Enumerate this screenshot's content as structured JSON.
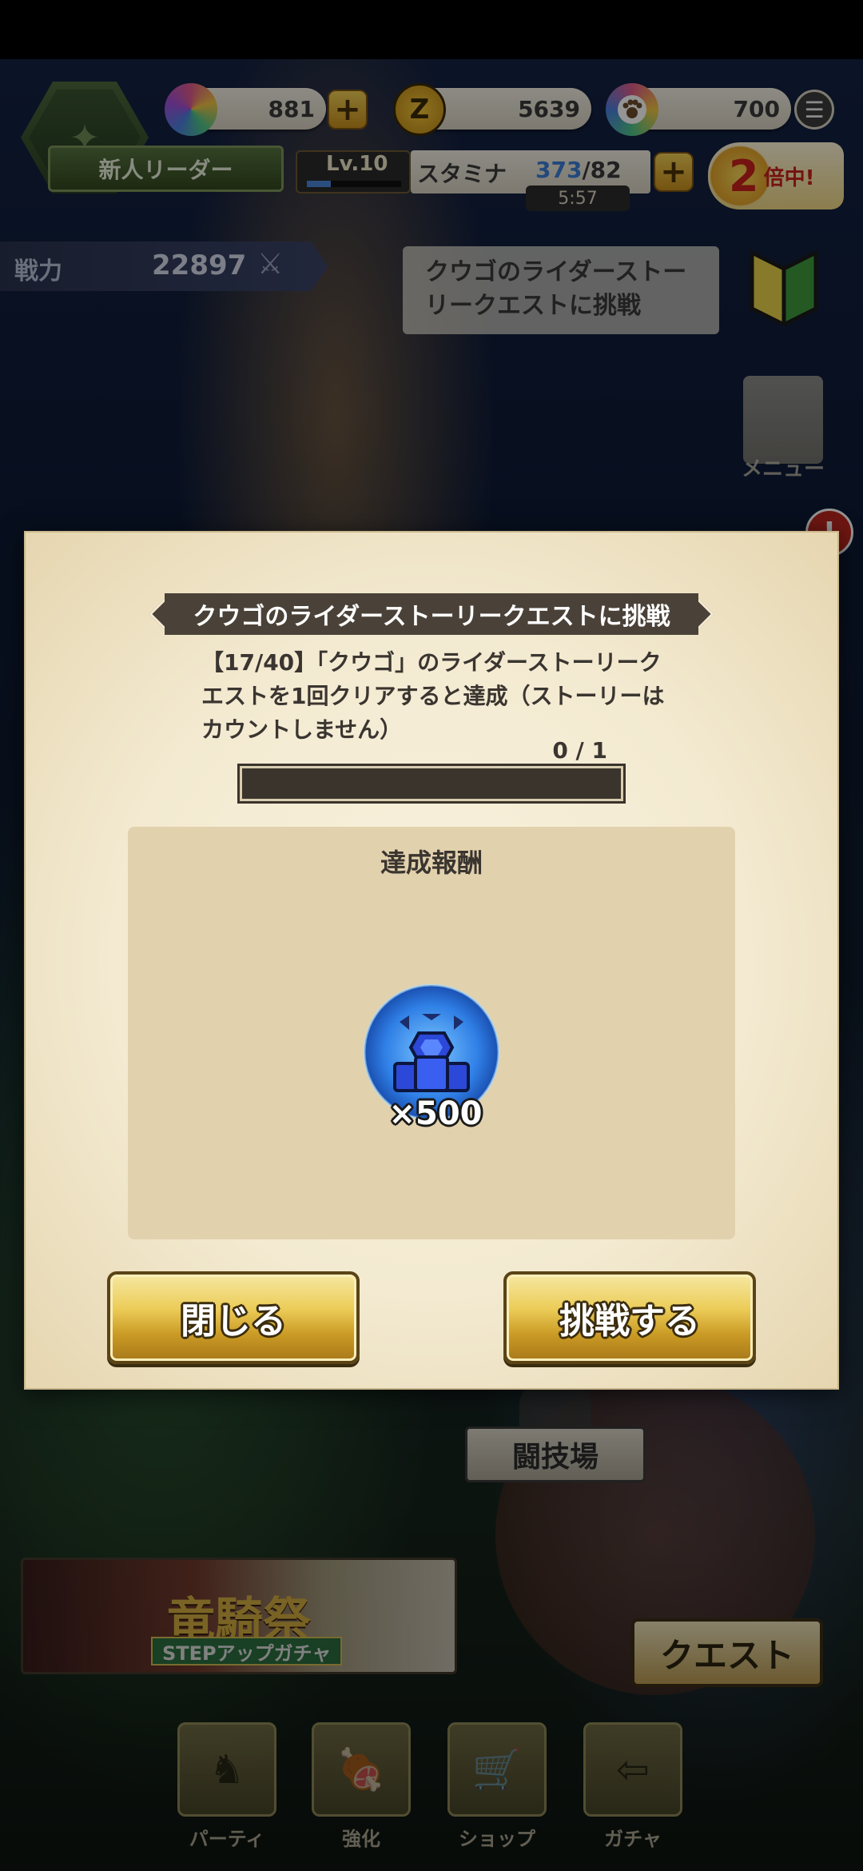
{
  "hud": {
    "leader_title": "新人リーダー",
    "gems": "881",
    "zenny": "5639",
    "points": "700",
    "level": "Lv.10",
    "level_progress": 0.25,
    "stamina_label": "スタミナ",
    "stamina_current": "373",
    "stamina_max": "/82",
    "stamina_timer": "5:57",
    "double_num": "2",
    "double_text": "倍中!",
    "power_label": "戦力",
    "power_value": "22897"
  },
  "mission": {
    "bubble_text": "クウゴのライダーストーリークエストに挑戦"
  },
  "side": {
    "menu_label": "メニュー",
    "notif": "!"
  },
  "dialog": {
    "title": "クウゴのライダーストーリークエストに挑戦",
    "description": "【17/40】「クウゴ」のライダーストーリークエストを1回クリアすると達成（ストーリーはカウントしません）",
    "progress_text": "0 / 1",
    "progress_value": 0,
    "reward_title": "達成報酬",
    "reward_icon": "blue-gem-icon",
    "reward_qty": "×500",
    "close_label": "閉じる",
    "challenge_label": "挑戦する"
  },
  "background": {
    "arena_label": "闘技場",
    "quest_label": "クエスト",
    "banner_title": "竜騎祭",
    "banner_sub": "STEPアップガチャ",
    "nav": [
      {
        "label": "パーティ",
        "icon": "party-icon"
      },
      {
        "label": "強化",
        "icon": "meat-icon"
      },
      {
        "label": "ショップ",
        "icon": "cart-icon"
      },
      {
        "label": "ガチャ",
        "icon": "signpost-icon"
      }
    ]
  },
  "colors": {
    "accent_gold": "#eccc58",
    "title_dark": "#4a4238",
    "stamina_blue": "#3d7fd6",
    "double_red": "#c8211a"
  }
}
